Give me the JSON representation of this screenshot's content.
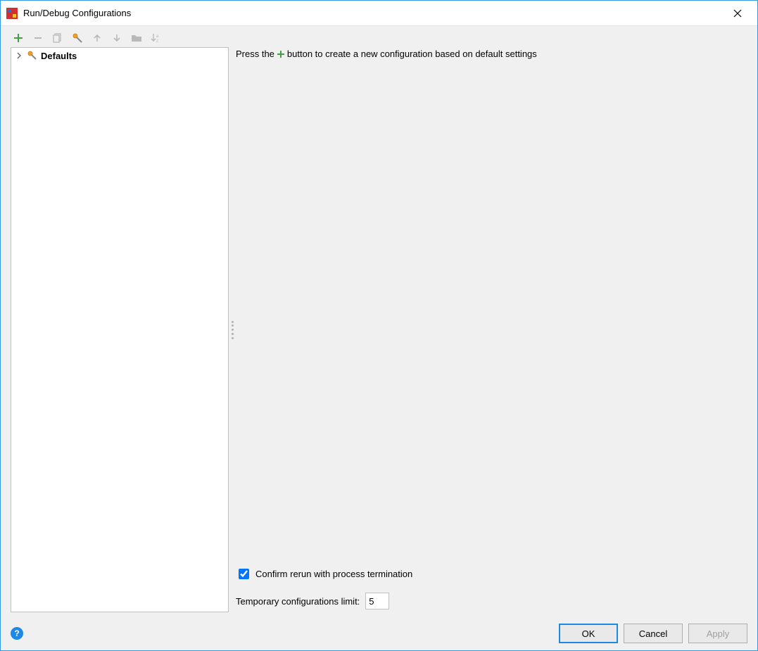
{
  "window": {
    "title": "Run/Debug Configurations"
  },
  "tree": {
    "defaults_label": "Defaults"
  },
  "hint": {
    "prefix": "Press the",
    "suffix": "button to create a new configuration based on default settings"
  },
  "options": {
    "confirm_label": "Confirm rerun with process termination",
    "confirm_checked": true,
    "limit_label": "Temporary configurations limit:",
    "limit_value": "5"
  },
  "footer": {
    "ok": "OK",
    "cancel": "Cancel",
    "apply": "Apply"
  }
}
